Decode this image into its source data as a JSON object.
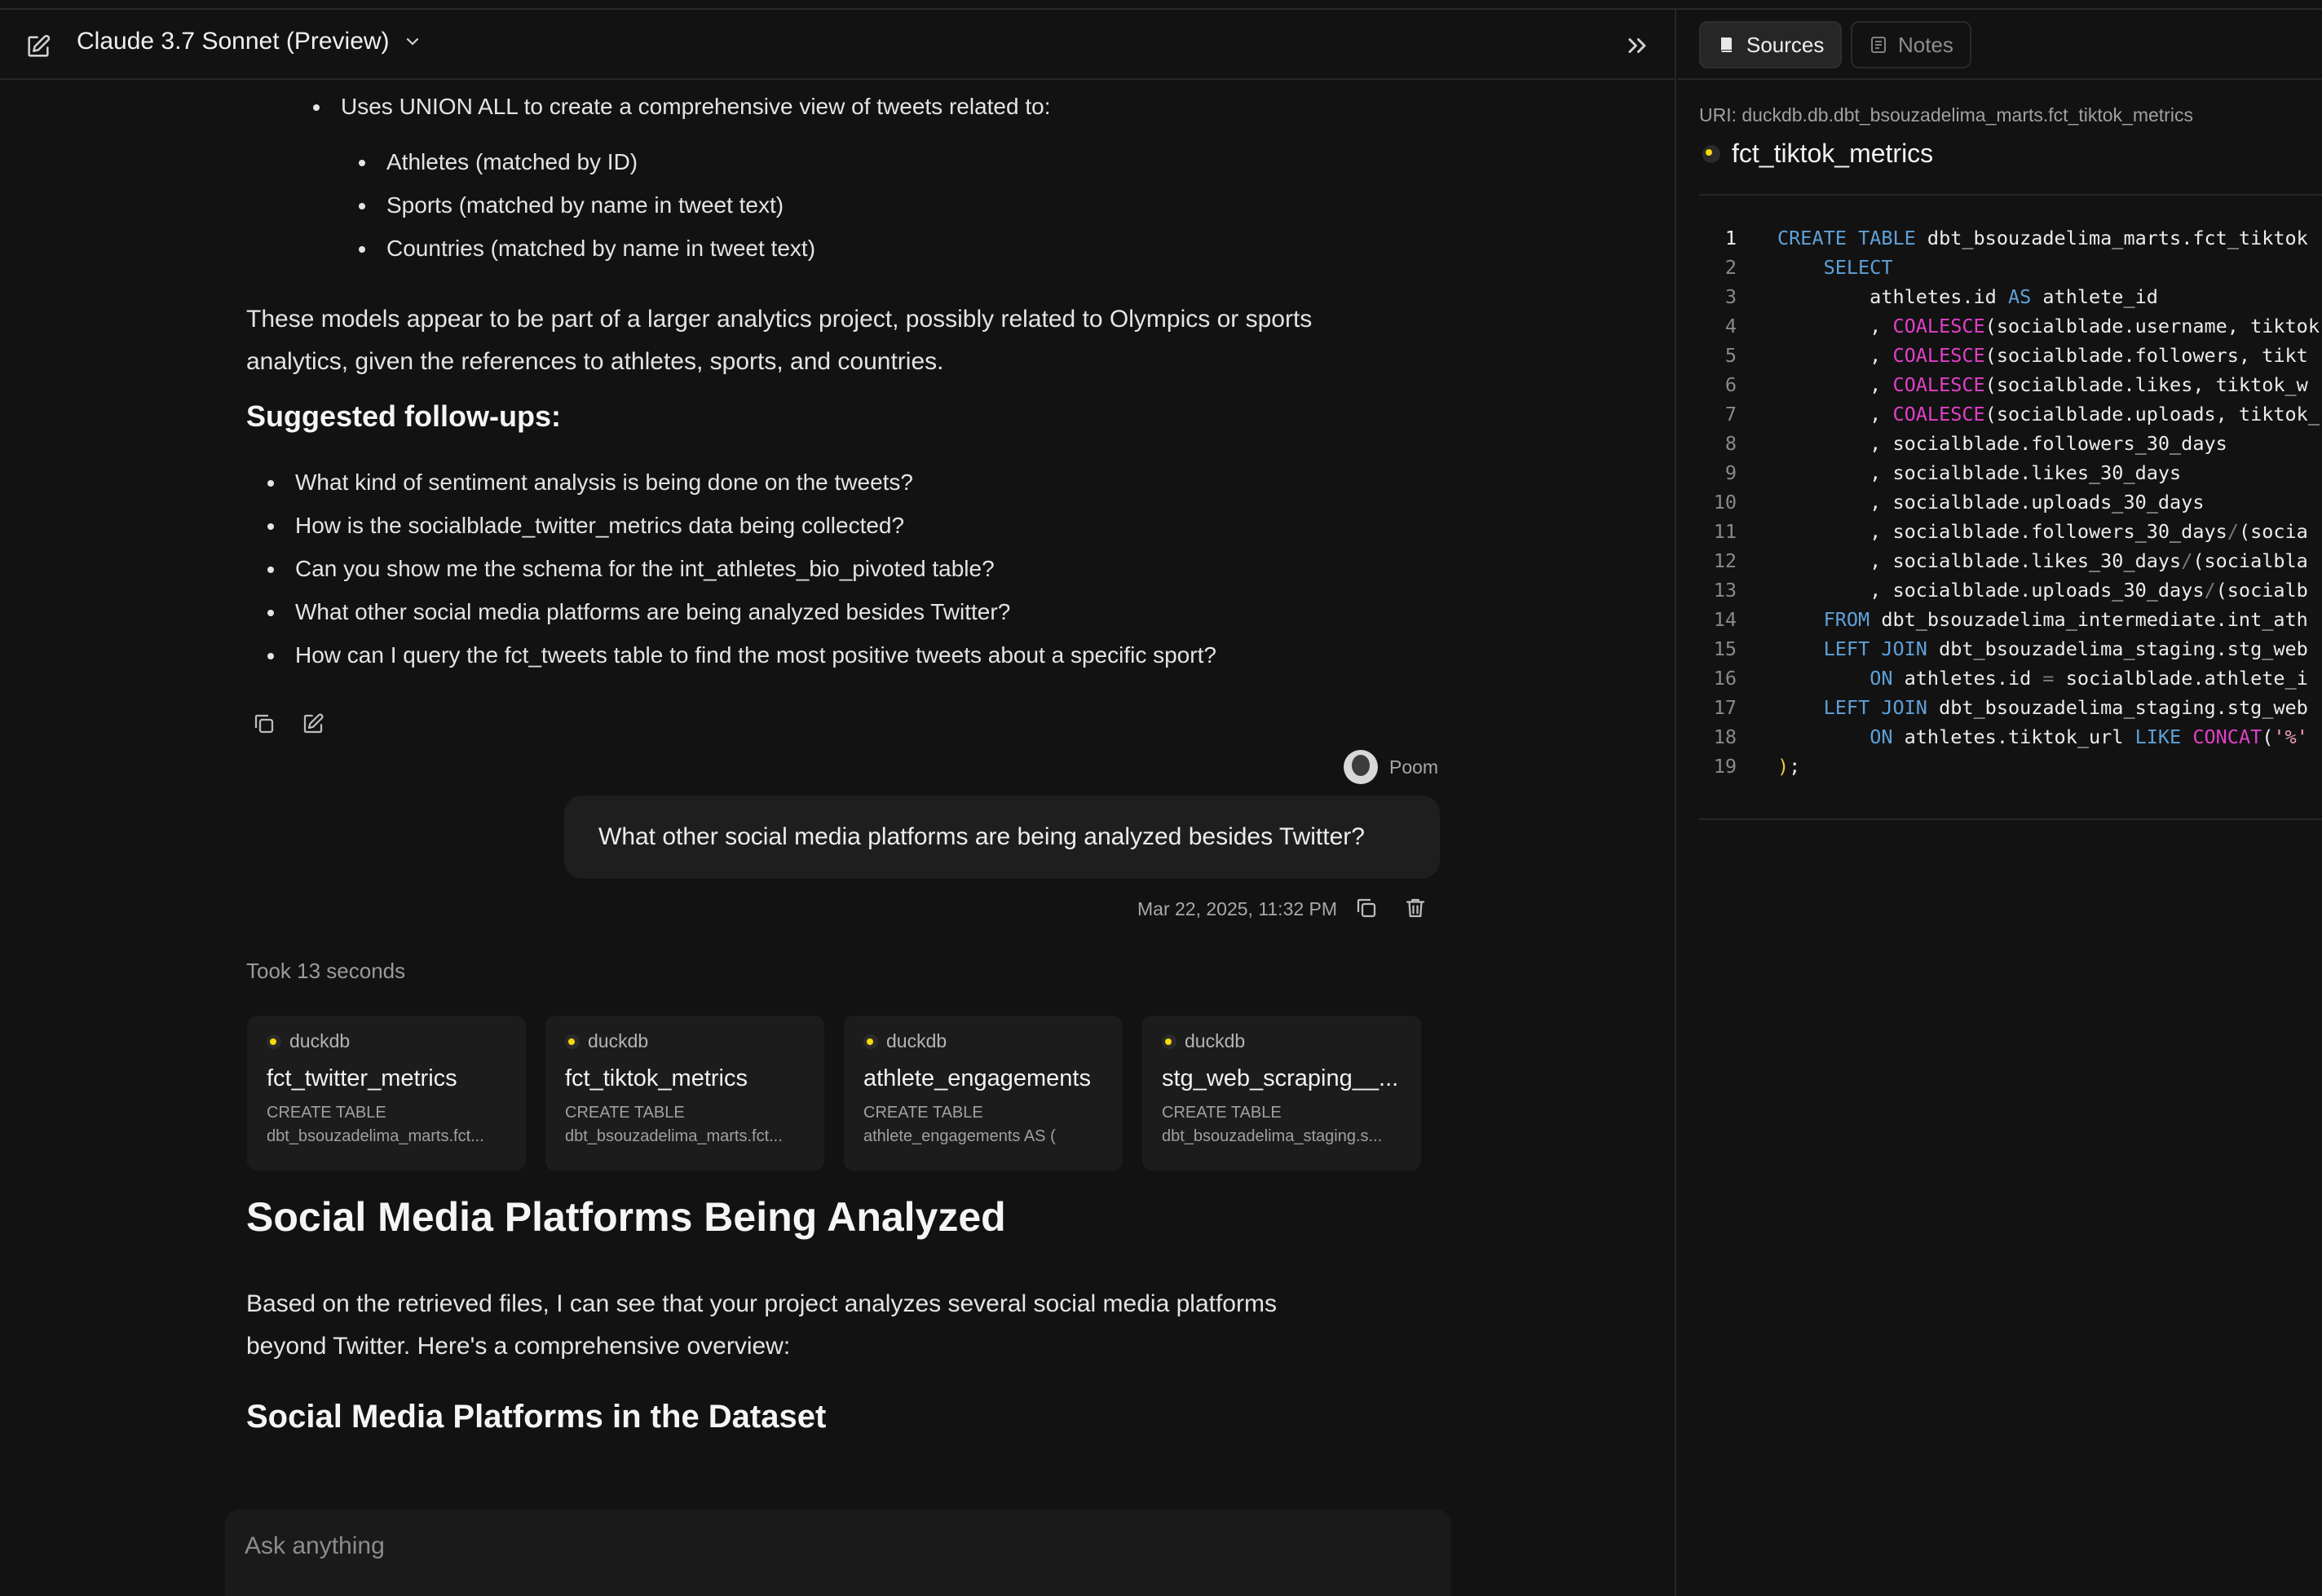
{
  "header": {
    "model_name": "Claude 3.7 Sonnet (Preview)"
  },
  "chat": {
    "union_bullet": "Uses UNION ALL to create a comprehensive view of tweets related to:",
    "union_subitems": [
      "Athletes (matched by ID)",
      "Sports (matched by name in tweet text)",
      "Countries (matched by name in tweet text)"
    ],
    "summary_line1": "These models appear to be part of a larger analytics project, possibly related to Olympics or sports",
    "summary_line2": "analytics, given the references to athletes, sports, and countries.",
    "followups_heading": "Suggested follow-ups:",
    "followups": [
      "What kind of sentiment analysis is being done on the tweets?",
      "How is the socialblade_twitter_metrics data being collected?",
      "Can you show me the schema for the int_athletes_bio_pivoted table?",
      "What other social media platforms are being analyzed besides Twitter?",
      "How can I query the fct_tweets table to find the most positive tweets about a specific sport?"
    ],
    "user_name": "Poom",
    "user_message": "What other social media platforms are being analyzed besides Twitter?",
    "message_time": "Mar 22, 2025, 11:32 PM",
    "took_text": "Took 13 seconds",
    "source_cards": [
      {
        "source": "duckdb",
        "name": "fct_twitter_metrics",
        "line1": "CREATE TABLE",
        "line2": "dbt_bsouzadelima_marts.fct..."
      },
      {
        "source": "duckdb",
        "name": "fct_tiktok_metrics",
        "line1": "CREATE TABLE",
        "line2": "dbt_bsouzadelima_marts.fct..."
      },
      {
        "source": "duckdb",
        "name": "athlete_engagements",
        "line1": "CREATE TABLE",
        "line2": "athlete_engagements AS ("
      },
      {
        "source": "duckdb",
        "name": "stg_web_scraping__...",
        "line1": "CREATE TABLE",
        "line2": "dbt_bsouzadelima_staging.s..."
      }
    ],
    "answer_heading": "Social Media Platforms Being Analyzed",
    "answer_line1": "Based on the retrieved files, I can see that your project analyzes several social media platforms",
    "answer_line2": "beyond Twitter. Here's a comprehensive overview:",
    "answer_subheading": "Social Media Platforms in the Dataset",
    "input_placeholder": "Ask anything"
  },
  "sidepanel": {
    "tabs": [
      "Sources",
      "Notes"
    ],
    "active_tab": "Sources",
    "uri": "URI: duckdb.db.dbt_bsouzadelima_marts.fct_tiktok_metrics",
    "file_title": "fct_tiktok_metrics",
    "code_lines": [
      "CREATE TABLE dbt_bsouzadelima_marts.fct_tiktok",
      "    SELECT",
      "        athletes.id AS athlete_id",
      "        , COALESCE(socialblade.username, tiktok",
      "        , COALESCE(socialblade.followers, tikt",
      "        , COALESCE(socialblade.likes, tiktok_w",
      "        , COALESCE(socialblade.uploads, tiktok_",
      "        , socialblade.followers_30_days",
      "        , socialblade.likes_30_days",
      "        , socialblade.uploads_30_days",
      "        , socialblade.followers_30_days/(socia",
      "        , socialblade.likes_30_days/(socialbla",
      "        , socialblade.uploads_30_days/(socialb",
      "    FROM dbt_bsouzadelima_intermediate.int_ath",
      "    LEFT JOIN dbt_bsouzadelima_staging.stg_web",
      "        ON athletes.id = socialblade.athlete_i",
      "    LEFT JOIN dbt_bsouzadelima_staging.stg_web",
      "        ON athletes.tiktok_url LIKE CONCAT('%'",
      ");"
    ]
  },
  "colors": {
    "background": "#121212",
    "keyword": "#5fa0d8",
    "function": "#e040c8",
    "duckdb_accent": "#f5d90a"
  }
}
